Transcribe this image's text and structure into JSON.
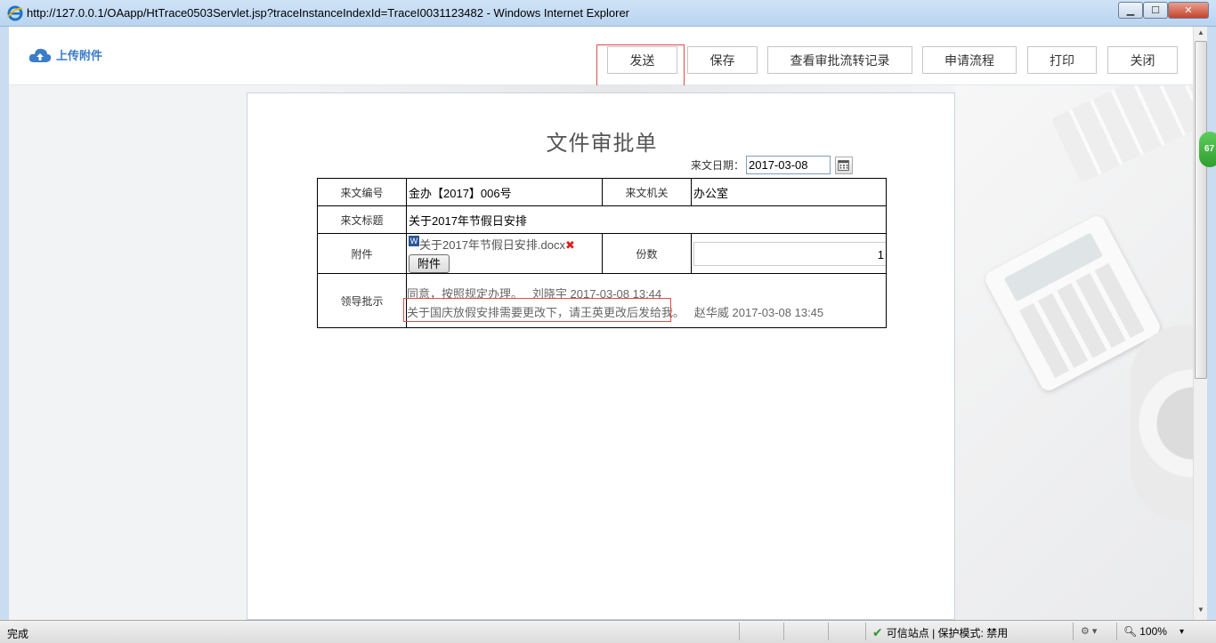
{
  "window": {
    "title": "http://127.0.0.1/OAapp/HtTrace0503Servlet.jsp?traceInstanceIndexId=TraceI0031123482 - Windows Internet Explorer"
  },
  "toolbar": {
    "upload_label": "上传附件",
    "buttons": [
      "发送",
      "保存",
      "查看审批流转记录",
      "申请流程",
      "打印",
      "关闭"
    ]
  },
  "form": {
    "title": "文件审批单",
    "date_label": "来文日期：",
    "date_value": "2017-03-08",
    "labels": {
      "doc_no": "来文编号",
      "issuer": "来文机关",
      "subject": "来文标题",
      "attachment": "附件",
      "copies": "份数",
      "leader_comment": "领导批示"
    },
    "values": {
      "doc_no": "金办【2017】006号",
      "issuer": "办公室",
      "subject": "关于2017年节假日安排",
      "attachment_file": "关于2017年节假日安排.docx",
      "attachment_button": "附件",
      "copies": "1"
    },
    "comments": [
      {
        "text": "同意，按照规定办理。",
        "author": "刘晓宇",
        "time": "2017-03-08 13:44"
      },
      {
        "text": "关于国庆放假安排需要更改下，请王英更改后发给我。",
        "author": "赵华威",
        "time": "2017-03-08 13:45"
      }
    ]
  },
  "sidebar_badge": "67",
  "statusbar": {
    "left": "完成",
    "zone": "可信站点 | 保护模式: 禁用",
    "zoom": "100%"
  },
  "icons": {
    "browser": "ie-icon",
    "upload": "cloud-upload-icon",
    "calendar": "calendar-icon",
    "word": "word-file-icon",
    "delete": "delete-icon",
    "trusted": "check-icon",
    "zoom": "magnifier-icon"
  }
}
